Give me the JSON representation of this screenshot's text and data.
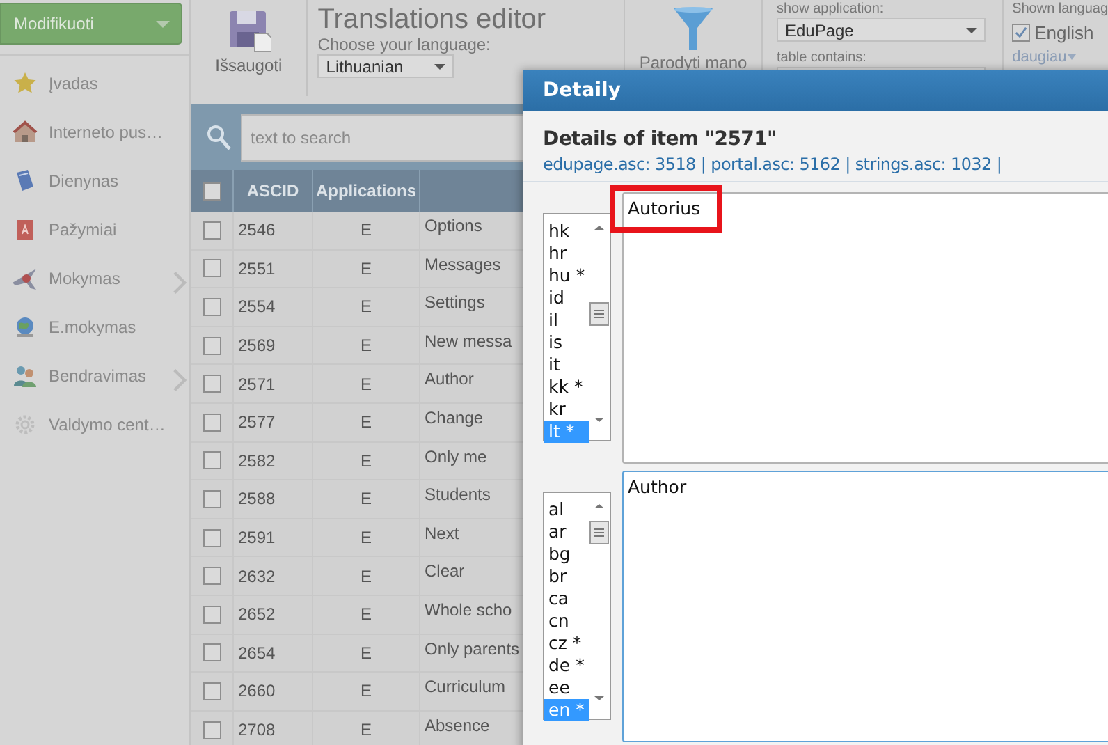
{
  "sidebar": {
    "menu_button": {
      "label": "Modifikuoti"
    },
    "items": [
      {
        "label": "Įvadas",
        "has_submenu": false
      },
      {
        "label": "Interneto pus…",
        "has_submenu": false
      },
      {
        "label": "Dienynas",
        "has_submenu": false
      },
      {
        "label": "Pažymiai",
        "has_submenu": false
      },
      {
        "label": "Mokymas",
        "has_submenu": true
      },
      {
        "label": "E.mokymas",
        "has_submenu": false
      },
      {
        "label": "Bendravimas",
        "has_submenu": true
      },
      {
        "label": "Valdymo cent…",
        "has_submenu": false
      }
    ]
  },
  "toolbar": {
    "save_button": "Išsaugoti",
    "title": "Translations editor",
    "language_label": "Choose your language:",
    "language_select": "Lithuanian",
    "filter_button": "Parodyti mano",
    "show_application_label": "show application:",
    "application_select": "EduPage",
    "table_contains_label": "table contains:",
    "shown_languages_label": "Shown languag",
    "languages": [
      {
        "label": "English",
        "checked": true
      }
    ],
    "more_link": "daugiau"
  },
  "search": {
    "placeholder": "text to search"
  },
  "table": {
    "all_checked": false,
    "columns": [
      "ASCID",
      "Applications"
    ],
    "rows": [
      {
        "checked": false,
        "ascid": "2546",
        "applications": "E",
        "column_3": "Options"
      },
      {
        "checked": false,
        "ascid": "2551",
        "applications": "E",
        "column_3": "Messages"
      },
      {
        "checked": false,
        "ascid": "2554",
        "applications": "E",
        "column_3": "Settings"
      },
      {
        "checked": false,
        "ascid": "2569",
        "applications": "E",
        "column_3": "New messa"
      },
      {
        "checked": false,
        "ascid": "2571",
        "applications": "E",
        "column_3": "Author"
      },
      {
        "checked": false,
        "ascid": "2577",
        "applications": "E",
        "column_3": "Change"
      },
      {
        "checked": false,
        "ascid": "2582",
        "applications": "E",
        "column_3": "Only me"
      },
      {
        "checked": false,
        "ascid": "2588",
        "applications": "E",
        "column_3": "Students"
      },
      {
        "checked": false,
        "ascid": "2591",
        "applications": "E",
        "column_3": "Next"
      },
      {
        "checked": false,
        "ascid": "2632",
        "applications": "E",
        "column_3": "Clear"
      },
      {
        "checked": false,
        "ascid": "2652",
        "applications": "E",
        "column_3": "Whole scho"
      },
      {
        "checked": false,
        "ascid": "2654",
        "applications": "E",
        "column_3": "Only parents"
      },
      {
        "checked": false,
        "ascid": "2660",
        "applications": "E",
        "column_3": "Curriculum"
      },
      {
        "checked": false,
        "ascid": "2708",
        "applications": "E",
        "column_3": "Absence"
      }
    ]
  },
  "dialog": {
    "title": "Detaily",
    "heading": "Details of item \"2571\"",
    "sources": "edupage.asc: 3518 | portal.asc: 5162 | strings.asc: 1032 |",
    "editors": [
      {
        "text": "Autorius",
        "focused": false,
        "highlighted": true,
        "languages": [
          {
            "code": "hk",
            "selected": false
          },
          {
            "code": "hr",
            "selected": false
          },
          {
            "code": "hu *",
            "selected": false
          },
          {
            "code": "id",
            "selected": false
          },
          {
            "code": "il",
            "selected": false
          },
          {
            "code": "is",
            "selected": false
          },
          {
            "code": "it",
            "selected": false
          },
          {
            "code": "kk *",
            "selected": false
          },
          {
            "code": "kr",
            "selected": false
          },
          {
            "code": "lt *",
            "selected": true
          }
        ]
      },
      {
        "text": "Author",
        "focused": true,
        "highlighted": false,
        "languages": [
          {
            "code": "al",
            "selected": false
          },
          {
            "code": "ar",
            "selected": false
          },
          {
            "code": "bg",
            "selected": false
          },
          {
            "code": "br",
            "selected": false
          },
          {
            "code": "ca",
            "selected": false
          },
          {
            "code": "cn",
            "selected": false
          },
          {
            "code": "cz *",
            "selected": false
          },
          {
            "code": "de *",
            "selected": false
          },
          {
            "code": "ee",
            "selected": false
          },
          {
            "code": "en *",
            "selected": true
          }
        ]
      }
    ]
  }
}
